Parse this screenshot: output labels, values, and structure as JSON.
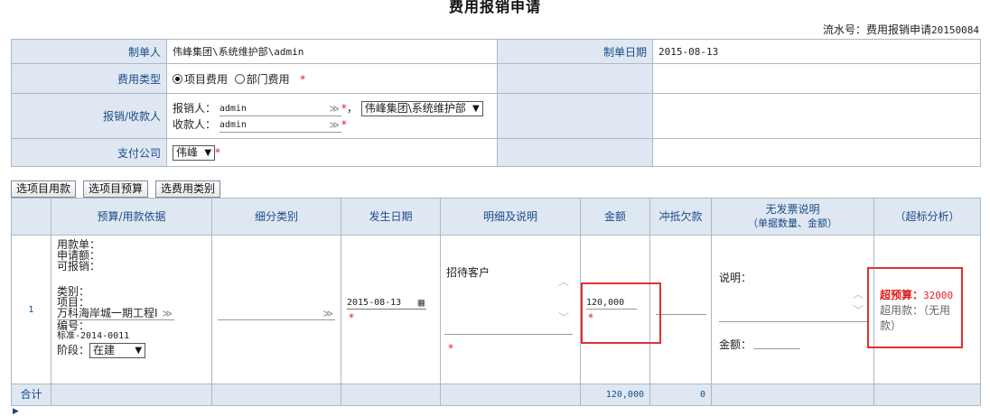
{
  "page": {
    "title": "费用报销申请",
    "serial_label": "流水号：费用报销申请",
    "serial_no": "20150084"
  },
  "form": {
    "maker_label": "制单人",
    "maker_value": "伟峰集团\\系统维护部\\admin",
    "date_label": "制单日期",
    "date_value": "2015-08-13",
    "expense_type_label": "费用类型",
    "expense_type_options": [
      "项目费用",
      "部门费用"
    ],
    "expense_type_selected": "项目费用",
    "reimburser_label": "报销/收款人",
    "reimburser_prefix": "报销人：",
    "reimburser_value": "admin",
    "reimburser_dept": "伟峰集团\\系统维护部",
    "payee_prefix": "收款人：",
    "payee_value": "admin",
    "comma": "，",
    "pay_company_label": "支付公司",
    "pay_company_value": "伟峰",
    "required_mark": "*"
  },
  "buttons": {
    "select_item_loan": "选项目用款",
    "select_item_budget": "选项目预算",
    "select_expense_type": "选费用类别"
  },
  "detail_table": {
    "headers": {
      "basis": "预算/用款依据",
      "subcategory": "细分类别",
      "date": "发生日期",
      "detail": "明细及说明",
      "amount": "金额",
      "offset": "冲抵欠款",
      "no_invoice_line1": "无发票说明",
      "no_invoice_line2": "（单据数量、金额）",
      "over_analysis": "（超标分析）"
    },
    "row": {
      "index": "1",
      "loan_label": "用款单：",
      "applied_label": "申请额：",
      "reimbursable_label": "可报销：",
      "category_label": "类别：",
      "project_label": "项目：",
      "project_value": "万科海岸城一期工程I",
      "code_label": "编号：",
      "code_value": "标准-2014-0011",
      "stage_label": "阶段：",
      "stage_value": "在建",
      "date_value": "2015-08-13",
      "detail_value": "招待客户",
      "amount_value": "120,000",
      "note_label": "说明：",
      "amount_label": "金额：",
      "over_budget_label": "超预算：",
      "over_budget_value": "32000",
      "over_loan_text": "超用款：（无用款）"
    },
    "total": {
      "label": "合计",
      "amount": "120,000",
      "offset": "0"
    }
  },
  "colors": {
    "accent_blue": "#1a4a8a",
    "header_bg": "#dfe8f2",
    "required_red": "#e02020",
    "highlight_red": "#e03030"
  }
}
